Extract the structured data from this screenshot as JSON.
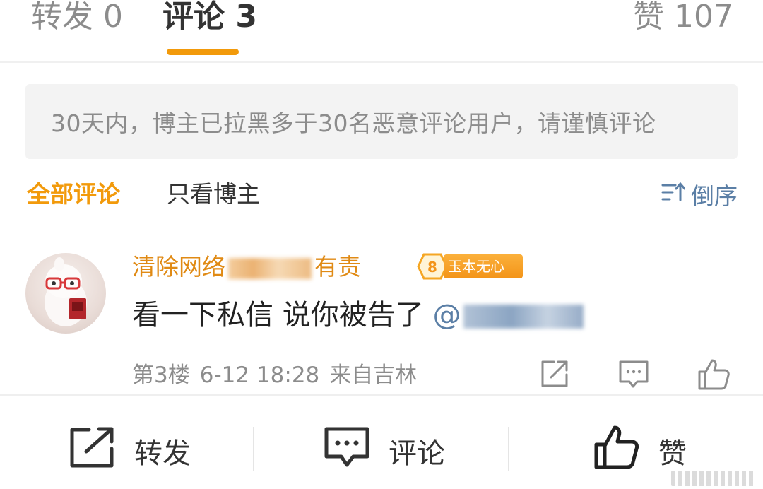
{
  "tabs": {
    "repost": "转发 0",
    "comment": "评论 3",
    "like": "赞 107"
  },
  "notice": "30天内，博主已拉黑多于30名恶意评论用户，请谨慎评论",
  "filters": {
    "all": "全部评论",
    "author_only": "只看博主",
    "sort": "倒序"
  },
  "comment": {
    "username_visible": {
      "start": "清除网络",
      "end": "有责"
    },
    "level": "8",
    "badge_label": "玉本无心",
    "text": "看一下私信 说你被告了 ",
    "mention_prefix": "@",
    "floor": "第3楼",
    "time": "6-12 18:28",
    "location": "来自吉林"
  },
  "bottom_bar": {
    "repost": "转发",
    "comment": "评论",
    "like": "赞"
  },
  "colors": {
    "accent": "#f29a0b",
    "link": "#5b7fa6",
    "muted": "#8c8c8c",
    "username": "#e08a14"
  }
}
